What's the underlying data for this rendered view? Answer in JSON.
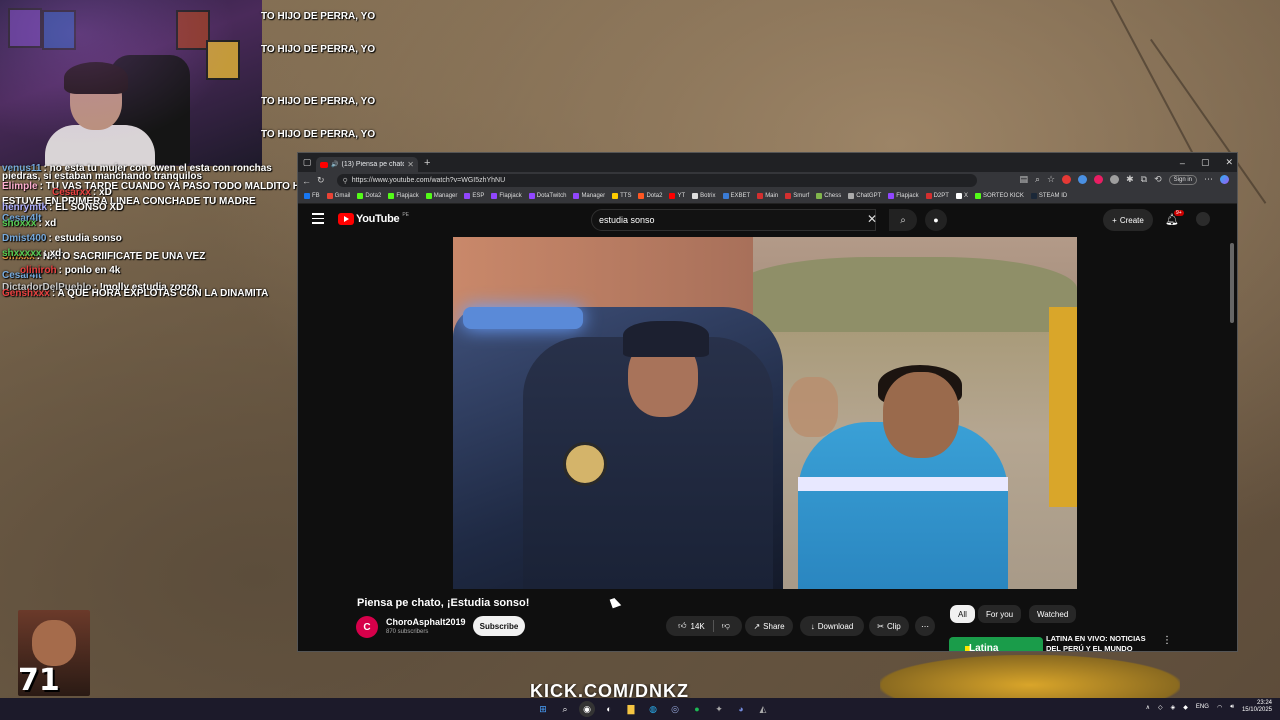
{
  "stream": {
    "ticker": [
      "TO HIJO DE PERRA, YO",
      "TO HIJO DE PERRA, YO",
      "TO HIJO DE PERRA, YO",
      "TO HIJO DE PERRA, YO"
    ],
    "chat": [
      {
        "user": "venus11",
        "msg": ": no esta tu mujer con owen el esta con ronchas"
      },
      {
        "user": "",
        "msg": "piedras, si estaban manchando tranquilos"
      },
      {
        "user": "Elimple",
        "msg": ": TU VAS TARDE CUANDO YA PASO TODO MALDITO HIJ"
      },
      {
        "user": "Cesarxx",
        "msg": ": xD"
      },
      {
        "user": "",
        "msg": "ESTUVE EN PRIMERA LINEA CONCHADE TU MADRE"
      },
      {
        "user": "henrymtk",
        "msg": ": EL SONSO XD"
      },
      {
        "user": "Cesar4lt",
        "msg": ""
      },
      {
        "user": "shoxxx",
        "msg": ": xd"
      },
      {
        "user": "Dmist400",
        "msg": ": estudia sonso"
      },
      {
        "user": "Sfhxxx",
        "msg": ": NATO SACRIIFICATE DE UNA VEZ"
      },
      {
        "user": "shxxxxx",
        "msg": ": xd"
      },
      {
        "user": "Cesar4lt",
        "msg": ""
      },
      {
        "user": "oliniroh",
        "msg": ": ponlo en 4k"
      },
      {
        "user": "DictadorDelPueblo",
        "msg": ": !molly estudia zonzo"
      },
      {
        "user": "Genshxxx",
        "msg": ": A QUE HORA EXPLOTAS CON LA DINAMITA"
      }
    ],
    "emote_number": "71",
    "kick_banner": "KICK.COM/DNKZ"
  },
  "browser": {
    "tab_title": "(13) Piensa pe chato, ¡Estudi...",
    "url": "https://www.youtube.com/watch?v=WGI5zhYhNU",
    "sign_in": "Sign in",
    "bookmarks": [
      {
        "label": "FB",
        "color": "#1877f2"
      },
      {
        "label": "Gmail",
        "color": "#ea4335"
      },
      {
        "label": "Dota2",
        "color": "#53fc18"
      },
      {
        "label": "Flapjack",
        "color": "#53fc18"
      },
      {
        "label": "Manager",
        "color": "#53fc18"
      },
      {
        "label": "ESP",
        "color": "#9146ff"
      },
      {
        "label": "Flapjack",
        "color": "#9146ff"
      },
      {
        "label": "DotaTwitch",
        "color": "#9146ff"
      },
      {
        "label": "Manager",
        "color": "#9146ff"
      },
      {
        "label": "TTS",
        "color": "#ffcc00"
      },
      {
        "label": "Dota2",
        "color": "#ff5722"
      },
      {
        "label": "YT",
        "color": "#ff0000"
      },
      {
        "label": "Botrix",
        "color": "#dddddd"
      },
      {
        "label": "EXBET",
        "color": "#3a7bd5"
      },
      {
        "label": "Main",
        "color": "#d32f2f"
      },
      {
        "label": "Smurf",
        "color": "#d32f2f"
      },
      {
        "label": "Chess",
        "color": "#81b64c"
      },
      {
        "label": "ChatGPT",
        "color": "#aaaaaa"
      },
      {
        "label": "Flapjack",
        "color": "#9146ff"
      },
      {
        "label": "D2PT",
        "color": "#d32f2f"
      },
      {
        "label": "X",
        "color": "#ffffff"
      },
      {
        "label": "SORTEO KICK",
        "color": "#53fc18"
      },
      {
        "label": "STEAM ID",
        "color": "#1b2838"
      }
    ]
  },
  "youtube": {
    "logo": "YouTube",
    "country": "PE",
    "search_value": "estudia sonso",
    "create_label": "Create",
    "notif_badge": "9+",
    "video_title": "Piensa pe chato, ¡Estudia sonso!",
    "channel_initial": "C",
    "channel_name": "ChoroAsphalt2019",
    "subscribers": "870 subscribers",
    "subscribe_label": "Subscribe",
    "likes": "14K",
    "share_label": "Share",
    "download_label": "Download",
    "clip_label": "Clip",
    "chips": [
      "All",
      "For you",
      "Watched"
    ],
    "rec_thumb_label": "Latina",
    "rec_title": "LATINA EN VIVO: NOTICIAS DEL PERÚ Y EL MUNDO"
  },
  "taskbar": {
    "lang": "ENG",
    "time": "23:24",
    "date": "15/10/2025"
  }
}
